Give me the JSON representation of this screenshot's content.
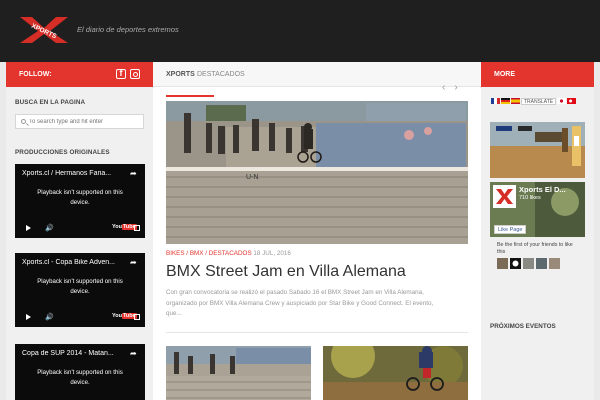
{
  "header": {
    "logo_text": "XPORTS",
    "tagline": "El diario de deportes extremos"
  },
  "left": {
    "follow_label": "FOLLOW:",
    "search_heading": "BUSCA EN LA PAGINA",
    "search_placeholder": "To search type and hit enter",
    "originals_heading": "PRODUCCIONES ORIGINALES",
    "videos": [
      {
        "title": "Xports.cl / Hermanos Faria...",
        "msg1": "Playback isn't supported on this",
        "msg2": "device."
      },
      {
        "title": "Xports.cl - Copa Bike Adven...",
        "msg1": "Playback isn't supported on this",
        "msg2": "device."
      },
      {
        "title": "Copa de SUP 2014 - Matan...",
        "msg1": "Playback isn't supported on this",
        "msg2": "device."
      }
    ]
  },
  "main": {
    "section_bold": "XPORTS",
    "section_light": "DESTACADOS",
    "post": {
      "cat1": "BIKES",
      "cat2": "BMX",
      "cat3": "DESTACADOS",
      "sep": " / ",
      "date": "18 JUL, 2016",
      "title": "BMX Street Jam en Villa Alemana",
      "excerpt1": "Con gran convocatoria se realizó el pasado Sabado 16 el BMX Street Jam en Villa Alemana,",
      "excerpt2": "organizado por BMX Villa Alemana Crew y auspiciado por Star Bike y Good Connect. El evento,",
      "excerpt3": "que..."
    }
  },
  "right": {
    "more_label": "MORE",
    "translate_label": "TRANSLATE",
    "fb_page_name": "Xports El D...",
    "fb_likes": "710 likes",
    "fb_like_button": "Like Page",
    "fb_friends_text": "Be the first of your friends to like this",
    "events_heading": "PRÓXIMOS EVENTOS"
  }
}
